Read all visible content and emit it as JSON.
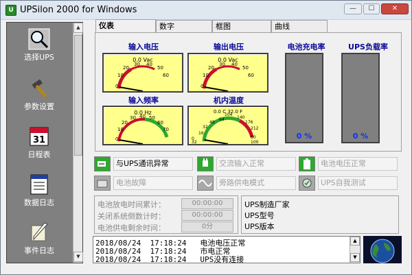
{
  "window": {
    "title": "UPSilon 2000 for Windows"
  },
  "sidebar": {
    "items": [
      {
        "label": "选择UPS",
        "icon": "magnifier-icon"
      },
      {
        "label": "参数设置",
        "icon": "hammer-icon"
      },
      {
        "label": "日程表",
        "icon": "calendar-icon",
        "calendar_day": "31"
      },
      {
        "label": "数据日志",
        "icon": "data-log-icon"
      },
      {
        "label": "事件日志",
        "icon": "quill-icon"
      }
    ]
  },
  "tabs": [
    {
      "label": "仪表",
      "active": true
    },
    {
      "label": "数字",
      "active": false
    },
    {
      "label": "框图",
      "active": false
    },
    {
      "label": "曲线",
      "active": false
    }
  ],
  "gauges": {
    "input_voltage": {
      "title": "输入电压",
      "readout": "0.0 Vac",
      "ticks": [
        "10",
        "20",
        "30",
        "40",
        "50",
        "60"
      ],
      "zero": "0",
      "value": 0
    },
    "output_voltage": {
      "title": "输出电压",
      "readout": "0.0 Vac",
      "ticks": [
        "10",
        "20",
        "30",
        "40",
        "50",
        "60"
      ],
      "zero": "0",
      "value": 0
    },
    "input_frequency": {
      "title": "输入频率",
      "readout": "0.0 Hz",
      "ticks": [
        "10",
        "20",
        "30",
        "40",
        "50",
        "60",
        "70"
      ],
      "zero": "0",
      "value": 0
    },
    "internal_temperature": {
      "title": "机内温度",
      "readout": "0.0 C   32.0 F",
      "ticks_c": [
        "16",
        "32",
        "48",
        "64"
      ],
      "ticks_f": [
        "104",
        "140",
        "176",
        "212"
      ],
      "zero_c": "0",
      "zero_f": "32",
      "extra_c": "80",
      "extra_f": "100",
      "value": 0
    }
  },
  "bars": {
    "battery_charge": {
      "title": "电池充电率",
      "value_text": "0 %",
      "percent": 0
    },
    "ups_load": {
      "title": "UPS负载率",
      "value_text": "0 %",
      "percent": 0
    }
  },
  "status": [
    {
      "text": "与UPS通讯异常",
      "active": true,
      "icon": "comm-error-icon"
    },
    {
      "text": "交流输入正常",
      "active": false,
      "icon": "ac-plug-icon"
    },
    {
      "text": "电池电压正常",
      "active": false,
      "icon": "battery-icon"
    },
    {
      "text": "电池故障",
      "active": false,
      "icon": "battery-fault-icon"
    },
    {
      "text": "旁路供电模式",
      "active": false,
      "icon": "bypass-wave-icon"
    },
    {
      "text": "UPS自我测试",
      "active": false,
      "icon": "self-test-icon"
    }
  ],
  "timers": [
    {
      "label": "电池放电时间累计：",
      "value": "00:00:00"
    },
    {
      "label": "关闭系统倒数计时：",
      "value": "00:00:00"
    },
    {
      "label": "电池供电剩余时间：",
      "value": "0分"
    }
  ],
  "ups_info": {
    "manufacturer": "UPS制造厂家",
    "model": "UPS型号",
    "version": "UPS版本"
  },
  "log": [
    {
      "date": "2018/08/24",
      "time": "17:18:24",
      "message": "电池电压正常"
    },
    {
      "date": "2018/08/24",
      "time": "17:18:24",
      "message": "市电正常"
    },
    {
      "date": "2018/08/24",
      "time": "17:18:24",
      "message": "UPS没有连接"
    }
  ],
  "colors": {
    "gauge_face": "#ffff8c",
    "gauge_red": "#c8102e",
    "gauge_green": "#2ea82e",
    "bar_value": "#1030ff",
    "sidebar_bg": "#808080"
  }
}
